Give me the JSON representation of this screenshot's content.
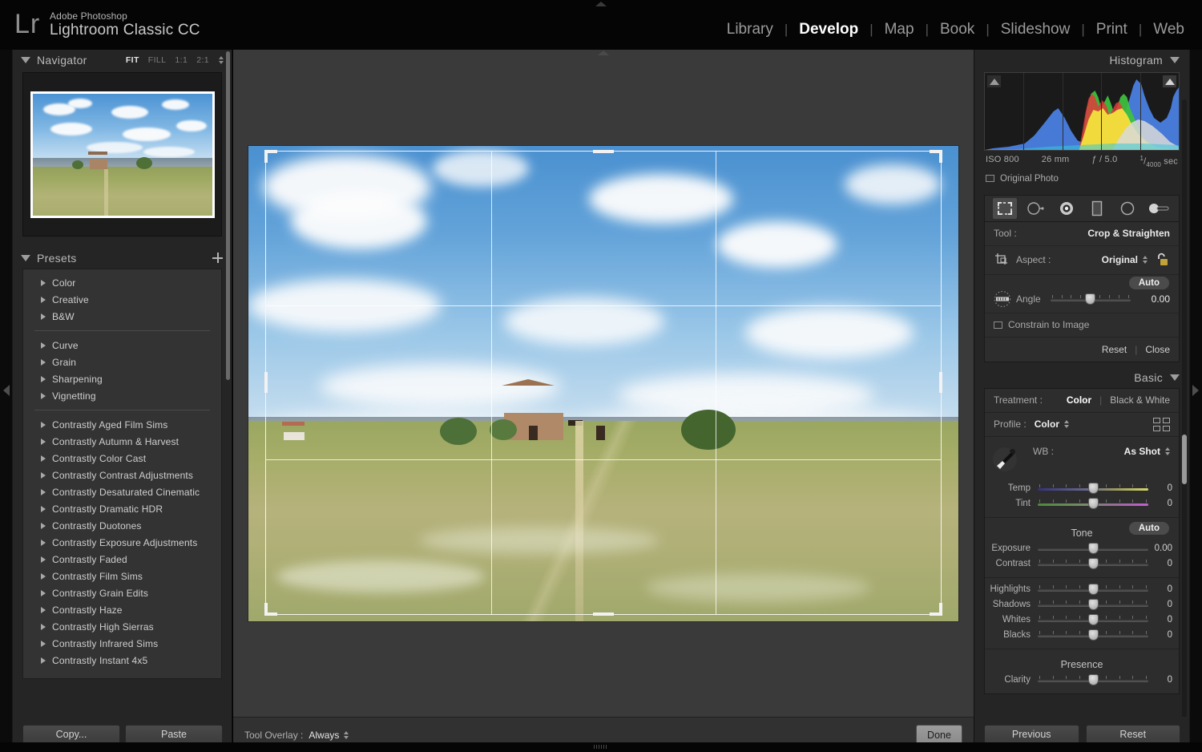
{
  "app": {
    "logo": "Lr",
    "brand_line1": "Adobe Photoshop",
    "brand_line2": "Lightroom Classic CC"
  },
  "modules": [
    {
      "label": "Library",
      "active": false
    },
    {
      "label": "Develop",
      "active": true
    },
    {
      "label": "Map",
      "active": false
    },
    {
      "label": "Book",
      "active": false
    },
    {
      "label": "Slideshow",
      "active": false
    },
    {
      "label": "Print",
      "active": false
    },
    {
      "label": "Web",
      "active": false
    }
  ],
  "navigator": {
    "title": "Navigator",
    "zoom_levels": [
      {
        "label": "FIT",
        "active": true
      },
      {
        "label": "FILL",
        "active": false
      },
      {
        "label": "1:1",
        "active": false
      },
      {
        "label": "2:1",
        "active": false
      }
    ]
  },
  "presets": {
    "title": "Presets",
    "add_label": "+",
    "groups_top": [
      "Color",
      "Creative",
      "B&W"
    ],
    "groups_mid": [
      "Curve",
      "Grain",
      "Sharpening",
      "Vignetting"
    ],
    "groups_user": [
      "Contrastly Aged Film Sims",
      "Contrastly Autumn & Harvest",
      "Contrastly Color Cast",
      "Contrastly Contrast Adjustments",
      "Contrastly Desaturated Cinematic",
      "Contrastly Dramatic HDR",
      "Contrastly Duotones",
      "Contrastly Exposure Adjustments",
      "Contrastly Faded",
      "Contrastly Film Sims",
      "Contrastly Grain Edits",
      "Contrastly Haze",
      "Contrastly High Sierras",
      "Contrastly Infrared Sims",
      "Contrastly Instant 4x5"
    ]
  },
  "left_bottom": {
    "copy_label": "Copy...",
    "paste_label": "Paste"
  },
  "center_toolbar": {
    "tool_overlay_label": "Tool Overlay :",
    "tool_overlay_value": "Always",
    "done_label": "Done"
  },
  "histogram": {
    "title": "Histogram",
    "exif": {
      "iso": "ISO 800",
      "focal": "26 mm",
      "aperture": "ƒ / 5.0",
      "shutter_num": "1",
      "shutter_den": "4000",
      "shutter_unit": "sec"
    },
    "original_photo_label": "Original Photo"
  },
  "tool_strip": {
    "tools": [
      {
        "name": "crop-overlay-tool",
        "active": true
      },
      {
        "name": "spot-removal-tool",
        "active": false
      },
      {
        "name": "red-eye-correction-tool",
        "active": false
      },
      {
        "name": "graduated-filter-tool",
        "active": false
      },
      {
        "name": "radial-filter-tool",
        "active": false
      },
      {
        "name": "adjustment-brush-tool",
        "active": false
      }
    ]
  },
  "crop_panel": {
    "tool_label": "Tool :",
    "tool_value": "Crop & Straighten",
    "aspect_label": "Aspect :",
    "aspect_value": "Original",
    "angle_label": "Angle",
    "angle_value": "0.00",
    "auto_label": "Auto",
    "constrain_label": "Constrain to Image",
    "reset_label": "Reset",
    "close_label": "Close"
  },
  "basic": {
    "title": "Basic",
    "treatment_label": "Treatment :",
    "treatment_options": [
      {
        "label": "Color",
        "active": true
      },
      {
        "label": "Black & White",
        "active": false
      }
    ],
    "profile_label": "Profile :",
    "profile_value": "Color",
    "wb_label": "WB :",
    "wb_value": "As Shot",
    "wb_sliders": [
      {
        "label": "Temp",
        "value": "0",
        "pos": 50,
        "kind": "temp"
      },
      {
        "label": "Tint",
        "value": "0",
        "pos": 50,
        "kind": "tint"
      }
    ],
    "tone_title": "Tone",
    "tone_auto_label": "Auto",
    "tone_sliders_top": [
      {
        "label": "Exposure",
        "value": "0.00",
        "pos": 50
      },
      {
        "label": "Contrast",
        "value": "0",
        "pos": 50
      }
    ],
    "tone_sliders_bottom": [
      {
        "label": "Highlights",
        "value": "0",
        "pos": 50
      },
      {
        "label": "Shadows",
        "value": "0",
        "pos": 50
      },
      {
        "label": "Whites",
        "value": "0",
        "pos": 50
      },
      {
        "label": "Blacks",
        "value": "0",
        "pos": 50
      }
    ],
    "presence_title": "Presence",
    "presence_sliders": [
      {
        "label": "Clarity",
        "value": "0",
        "pos": 50
      }
    ]
  },
  "right_bottom": {
    "previous_label": "Previous",
    "reset_label": "Reset"
  },
  "colors": {
    "panel_bg": "#252525",
    "canvas_bg": "#3a3a3a",
    "accent_text": "#ffffff",
    "slider_knob": "#c8c8c8",
    "histogram_red": "#e03b3b",
    "histogram_green": "#3fc23f",
    "histogram_blue": "#4a7fe0",
    "histogram_yellow": "#f2e23c"
  }
}
